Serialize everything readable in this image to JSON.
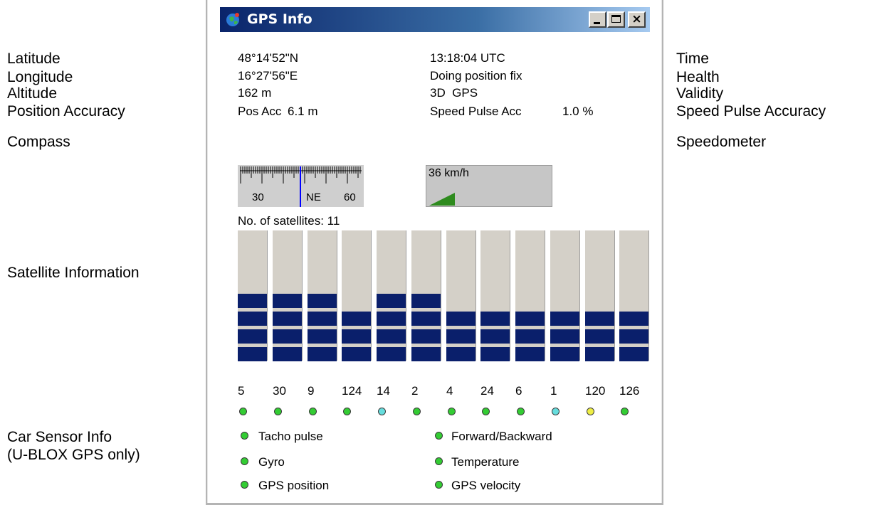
{
  "annotations": {
    "latitude": "Latitude",
    "longitude": "Longitude",
    "altitude": "Altitude",
    "position_accuracy": "Position Accuracy",
    "compass": "Compass",
    "satellite_information": "Satellite Information",
    "car_sensor_info_line1": "Car Sensor Info",
    "car_sensor_info_line2": "(U-BLOX GPS only)",
    "time": "Time",
    "health": "Health",
    "validity": "Validity",
    "speed_pulse_accuracy": "Speed Pulse Accuracy",
    "speedometer": "Speedometer"
  },
  "window": {
    "title": "GPS Info",
    "icon": "globe-icon",
    "close_glyph": "×"
  },
  "position": {
    "latitude": "48°14'52\"N",
    "longitude": "16°27'56\"E",
    "altitude": "162 m",
    "pos_acc_label": "Pos Acc",
    "pos_acc_value": "6.1 m"
  },
  "status": {
    "time": "13:18:04 UTC",
    "health": "Doing position fix",
    "validity": "3D  GPS",
    "speed_pulse_acc_label": "Speed Pulse Acc",
    "speed_pulse_acc_value": "1.0 %"
  },
  "compass": {
    "tick_left": "30",
    "heading": "NE",
    "tick_right": "60",
    "needle_color": "#0000ff"
  },
  "speedometer": {
    "speed": "36 km/h",
    "wedge_color": "#2e8b1e"
  },
  "satellites": {
    "count_label": "No. of satellites: 11",
    "bar_color": "#0a1f6b",
    "items": [
      {
        "id": "5",
        "level": 4,
        "dot": "green"
      },
      {
        "id": "30",
        "level": 4,
        "dot": "green"
      },
      {
        "id": "9",
        "level": 4,
        "dot": "green"
      },
      {
        "id": "124",
        "level": 3,
        "dot": "green"
      },
      {
        "id": "14",
        "level": 4,
        "dot": "cyan"
      },
      {
        "id": "2",
        "level": 4,
        "dot": "green"
      },
      {
        "id": "4",
        "level": 3,
        "dot": "green"
      },
      {
        "id": "24",
        "level": 3,
        "dot": "green"
      },
      {
        "id": "6",
        "level": 3,
        "dot": "green"
      },
      {
        "id": "1",
        "level": 3,
        "dot": "cyan"
      },
      {
        "id": "120",
        "level": 3,
        "dot": "yellow"
      },
      {
        "id": "126",
        "level": 3,
        "dot": "green"
      }
    ]
  },
  "dot_colors": {
    "green": "#33cc33",
    "cyan": "#66dddd",
    "yellow": "#eeee44"
  },
  "sensors": {
    "tacho_pulse": "Tacho pulse",
    "gyro": "Gyro",
    "gps_position": "GPS position",
    "forward_backward": "Forward/Backward",
    "temperature": "Temperature",
    "gps_velocity": "GPS velocity"
  }
}
